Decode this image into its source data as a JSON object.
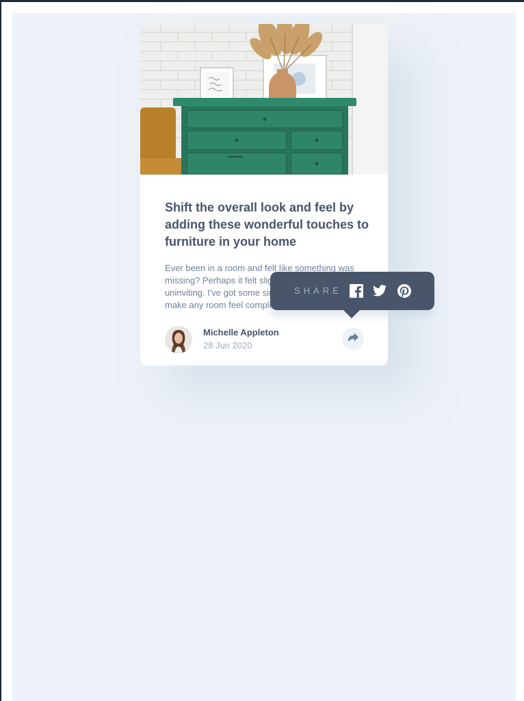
{
  "article": {
    "image_alt": "Green drawer with a vase of dried pampas grass and framed prints against a white brick wall",
    "title": "Shift the overall look and feel by adding these wonderful touches to furniture in your home",
    "excerpt": "Ever been in a room and felt like something was missing? Perhaps it felt slightly bare and uninviting. I've got some simple tips to help you make any room feel complete."
  },
  "author": {
    "name": "Michelle Appleton",
    "date": "28 Jun 2020"
  },
  "share": {
    "label": "SHARE",
    "networks": [
      "facebook-icon",
      "twitter-icon",
      "pinterest-icon"
    ],
    "share_icon": "share-arrow-icon"
  },
  "colors": {
    "page_background": "#ecf2f8",
    "card_background": "#ffffff",
    "heading": "#48556a",
    "body_text": "#6e8098",
    "muted_text": "#9eafc2",
    "tooltip_background": "#48556a",
    "icon_white": "#ffffff"
  }
}
